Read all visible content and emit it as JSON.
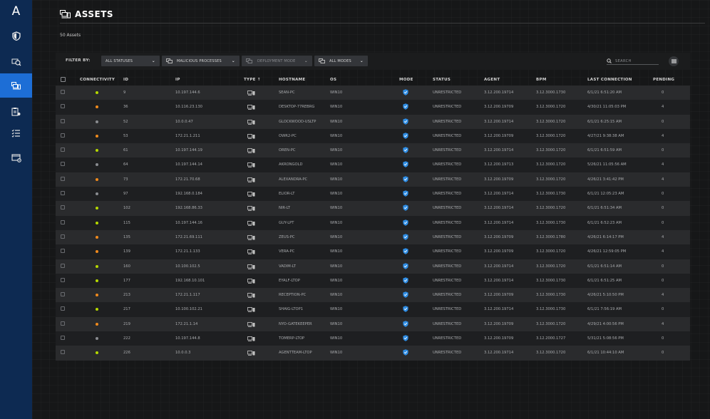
{
  "app": {
    "logo_letter": "A"
  },
  "sidebar": {
    "items": [
      {
        "name": "shield-icon",
        "active": false
      },
      {
        "name": "search-device-icon",
        "active": false
      },
      {
        "name": "assets-icon",
        "active": true
      },
      {
        "name": "clipboard-icon",
        "active": false
      },
      {
        "name": "checklist-icon",
        "active": false
      },
      {
        "name": "window-settings-icon",
        "active": false
      }
    ]
  },
  "header": {
    "title": "ASSETS",
    "count_text": "50 Assets"
  },
  "filters": {
    "label": "FILTER BY:",
    "status": "ALL STATUSES",
    "processes": "MALICIOUS PROCESSES",
    "deployment": "DEPLOYMENT MODE",
    "modes": "ALL MODES",
    "search_placeholder": "SEARCH"
  },
  "table": {
    "headers": {
      "connectivity": "CONNECTIVITY",
      "id": "ID",
      "ip": "IP",
      "type": "TYPE ↑",
      "hostname": "HOSTNAME",
      "os": "OS",
      "mode": "MODE",
      "status": "STATUS",
      "agent": "AGENT",
      "bpm": "BPM",
      "last_connection": "LAST CONNECTION",
      "pending": "PENDING"
    },
    "rows": [
      {
        "dot": "#b5d800",
        "id": "9",
        "ip": "10.197.144.6",
        "hostname": "SEAN-PC",
        "os": "WIN10",
        "status": "UNRESTRICTED",
        "agent": "3.12.200.19714",
        "bpm": "3.12.3000.1730",
        "last": "6/1/21 6:51:20 AM",
        "pending": "0"
      },
      {
        "dot": "#f08a1c",
        "id": "36",
        "ip": "10.116.23.130",
        "hostname": "DESKTOP-77REBRG",
        "os": "WIN10",
        "status": "UNRESTRICTED",
        "agent": "3.12.200.19709",
        "bpm": "3.12.3000.1720",
        "last": "4/30/21 11:05:03 PM",
        "pending": "4"
      },
      {
        "dot": "#8a8c90",
        "id": "52",
        "ip": "10.0.0.47",
        "hostname": "GLOCKWOOD-USLTP",
        "os": "WIN10",
        "status": "UNRESTRICTED",
        "agent": "3.12.200.19714",
        "bpm": "3.12.3000.1720",
        "last": "6/1/21 6:25:15 AM",
        "pending": "0"
      },
      {
        "dot": "#f08a1c",
        "id": "53",
        "ip": "172.21.1.211",
        "hostname": "OWR2-PC",
        "os": "WIN10",
        "status": "UNRESTRICTED",
        "agent": "3.12.200.19709",
        "bpm": "3.12.3000.1720",
        "last": "4/27/21 9:38:38 AM",
        "pending": "4"
      },
      {
        "dot": "#b5d800",
        "id": "61",
        "ip": "10.197.144.19",
        "hostname": "OREN-PC",
        "os": "WIN10",
        "status": "UNRESTRICTED",
        "agent": "3.12.200.19714",
        "bpm": "3.12.3000.1720",
        "last": "6/1/21 6:51:59 AM",
        "pending": "0"
      },
      {
        "dot": "#8a8c90",
        "id": "64",
        "ip": "10.197.144.14",
        "hostname": "AKRONGOLD",
        "os": "WIN10",
        "status": "UNRESTRICTED",
        "agent": "3.12.200.19713",
        "bpm": "3.12.3000.1720",
        "last": "5/26/21 11:05:56 AM",
        "pending": "4"
      },
      {
        "dot": "#f08a1c",
        "id": "73",
        "ip": "172.21.70.68",
        "hostname": "ALEXANDRA-PC",
        "os": "WIN10",
        "status": "UNRESTRICTED",
        "agent": "3.12.200.19709",
        "bpm": "3.12.3000.1720",
        "last": "4/26/21 3:41:42 PM",
        "pending": "4"
      },
      {
        "dot": "#8a8c90",
        "id": "97",
        "ip": "192.168.0.184",
        "hostname": "ELIOR-LT",
        "os": "WIN10",
        "status": "UNRESTRICTED",
        "agent": "3.12.200.19714",
        "bpm": "3.12.3000.1730",
        "last": "6/1/21 12:05:23 AM",
        "pending": "0"
      },
      {
        "dot": "#b5d800",
        "id": "102",
        "ip": "192.168.86.33",
        "hostname": "NIR-LT",
        "os": "WIN10",
        "status": "UNRESTRICTED",
        "agent": "3.12.200.19714",
        "bpm": "3.12.3000.1720",
        "last": "6/1/21 6:51:34 AM",
        "pending": "0"
      },
      {
        "dot": "#b5d800",
        "id": "115",
        "ip": "10.197.144.16",
        "hostname": "GUY-LPT",
        "os": "WIN10",
        "status": "UNRESTRICTED",
        "agent": "3.12.200.19714",
        "bpm": "3.12.3000.1730",
        "last": "6/1/21 6:52:23 AM",
        "pending": "0"
      },
      {
        "dot": "#f08a1c",
        "id": "135",
        "ip": "172.21.69.111",
        "hostname": "ZEUS-PC",
        "os": "WIN10",
        "status": "UNRESTRICTED",
        "agent": "3.12.200.19709",
        "bpm": "3.12.3000.1780",
        "last": "4/26/21 6:14:17 PM",
        "pending": "4"
      },
      {
        "dot": "#f08a1c",
        "id": "139",
        "ip": "172.21.1.133",
        "hostname": "VERA-PC",
        "os": "WIN10",
        "status": "UNRESTRICTED",
        "agent": "3.12.200.19709",
        "bpm": "3.12.3000.1720",
        "last": "4/26/21 12:59:05 PM",
        "pending": "4"
      },
      {
        "dot": "#b5d800",
        "id": "160",
        "ip": "10.100.102.5",
        "hostname": "VADIM-LT",
        "os": "WIN10",
        "status": "UNRESTRICTED",
        "agent": "3.12.200.19714",
        "bpm": "3.12.3000.1720",
        "last": "6/1/21 6:51:14 AM",
        "pending": "0"
      },
      {
        "dot": "#b5d800",
        "id": "177",
        "ip": "192.168.10.101",
        "hostname": "EYALF-LTOP",
        "os": "WIN10",
        "status": "UNRESTRICTED",
        "agent": "3.12.200.19714",
        "bpm": "3.12.3000.1730",
        "last": "6/1/21 6:51:25 AM",
        "pending": "0"
      },
      {
        "dot": "#f08a1c",
        "id": "213",
        "ip": "172.21.1.117",
        "hostname": "RECEPTION-PC",
        "os": "WIN10",
        "status": "UNRESTRICTED",
        "agent": "3.12.200.19709",
        "bpm": "3.12.3000.1730",
        "last": "4/26/21 5:10:50 PM",
        "pending": "4"
      },
      {
        "dot": "#b5d800",
        "id": "217",
        "ip": "10.100.102.21",
        "hostname": "SHAIG-LTOP1",
        "os": "WIN10",
        "status": "UNRESTRICTED",
        "agent": "3.12.200.19714",
        "bpm": "3.12.3000.1730",
        "last": "6/1/21 7:56:19 AM",
        "pending": "0"
      },
      {
        "dot": "#f08a1c",
        "id": "219",
        "ip": "172.21.1.14",
        "hostname": "NYO-GATEKEEPER",
        "os": "WIN10",
        "status": "UNRESTRICTED",
        "agent": "3.12.200.19709",
        "bpm": "3.12.3000.1720",
        "last": "4/29/21 4:00:56 PM",
        "pending": "4"
      },
      {
        "dot": "#8a8c90",
        "id": "222",
        "ip": "10.197.144.8",
        "hostname": "TOMERP-LTOP",
        "os": "WIN10",
        "status": "UNRESTRICTED",
        "agent": "3.12.200.19709",
        "bpm": "3.12.2000.1727",
        "last": "5/31/21 5:08:56 PM",
        "pending": "0"
      },
      {
        "dot": "#b5d800",
        "id": "226",
        "ip": "10.0.0.3",
        "hostname": "AGENTTEAM-LTOP",
        "os": "WIN10",
        "status": "UNRESTRICTED",
        "agent": "3.12.200.19714",
        "bpm": "3.12.3000.1720",
        "last": "6/1/21 10:44:10 AM",
        "pending": "0"
      }
    ]
  }
}
